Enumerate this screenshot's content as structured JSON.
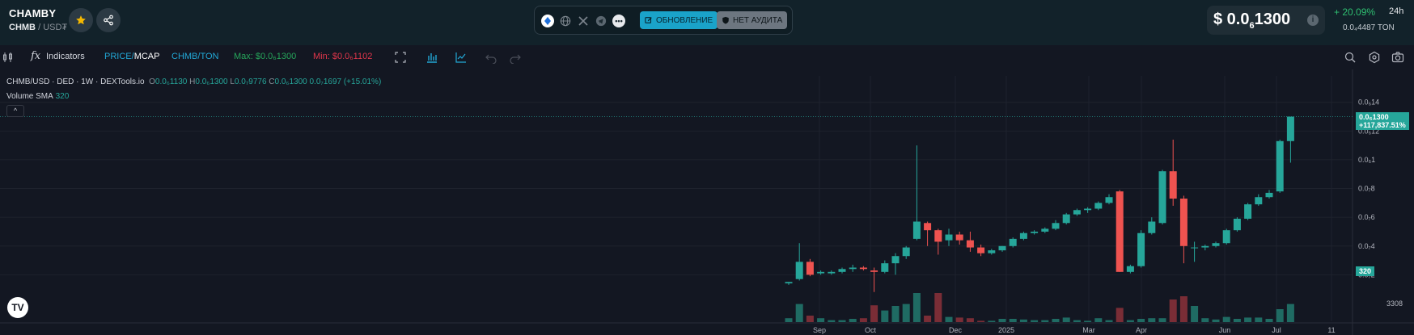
{
  "header": {
    "token_name": "CHAMBY",
    "pair_base": "CHMB",
    "pair_sep": "/",
    "pair_quote": "USD₮",
    "social": {
      "update_label": "ОБНОВЛЕНИЕ",
      "audit_label": "НЕТ АУДИТА"
    },
    "price": {
      "prefix": "$ 0.0",
      "subscript": "6",
      "suffix": "1300",
      "info": "i"
    },
    "change": "+ 20.09%",
    "change_period": "24h",
    "ton_price": "0.0₄4487  TON"
  },
  "toolbar": {
    "indicators": "Indicators",
    "price": "PRICE",
    "mcap": "MCAP",
    "pair": "CHMB/TON",
    "max": "Max: $0.0₆1300",
    "min": "Min: $0.0₆1102"
  },
  "legend": {
    "symbol": "CHMB/USD · DED · 1W · DEXTools.io",
    "o_label": "O",
    "o_val": "0.0₆1130",
    "h_label": "H",
    "h_val": "0.0₆1300",
    "l_label": "L",
    "l_val": "0.0₇9776",
    "c_label": "C",
    "c_val": "0.0₆1300 0.0₇1697 (+15.01%)",
    "volume": "Volume SMA",
    "volume_val": "320"
  },
  "colors": {
    "up": "#26a69a",
    "down": "#ef5350",
    "accent": "#22a8d6",
    "bg": "#131722"
  },
  "chart_data": {
    "type": "candlestick",
    "unit_note_ticks": [
      "0.0₆1",
      "0.0₆8",
      "0.0₆6",
      "0.0₆4",
      "0.0₆2"
    ],
    "y_ticks": [
      {
        "label": "0.0₆14",
        "value": 1.4
      },
      {
        "label": "0.0₆12",
        "value": 1.2
      },
      {
        "label": "0.0₆1",
        "value": 1.0
      },
      {
        "label": "0.0₇8",
        "value": 0.8
      },
      {
        "label": "0.0₇6",
        "value": 0.6
      },
      {
        "label": "0.0₇4",
        "value": 0.4
      },
      {
        "label": "0.0₇2",
        "value": 0.2
      }
    ],
    "x_ticks": [
      "Sep",
      "Oct",
      "Dec",
      "2025",
      "Mar",
      "Apr",
      "Jun",
      "Jul",
      "11"
    ],
    "last_price_tag": "0.0₆1300",
    "last_change_tag": "+117,837.51%",
    "volume_tag": "320",
    "volume_axis_label": "3308",
    "ylim": [
      0.0,
      1.55
    ],
    "candles": [
      {
        "o": 0.14,
        "h": 0.15,
        "l": 0.13,
        "c": 0.15
      },
      {
        "o": 0.17,
        "h": 0.42,
        "l": 0.16,
        "c": 0.29
      },
      {
        "o": 0.29,
        "h": 0.31,
        "l": 0.19,
        "c": 0.2
      },
      {
        "o": 0.21,
        "h": 0.23,
        "l": 0.2,
        "c": 0.22
      },
      {
        "o": 0.21,
        "h": 0.23,
        "l": 0.2,
        "c": 0.22
      },
      {
        "o": 0.22,
        "h": 0.25,
        "l": 0.21,
        "c": 0.24
      },
      {
        "o": 0.24,
        "h": 0.27,
        "l": 0.22,
        "c": 0.25
      },
      {
        "o": 0.25,
        "h": 0.26,
        "l": 0.23,
        "c": 0.24
      },
      {
        "o": 0.23,
        "h": 0.25,
        "l": 0.08,
        "c": 0.22
      },
      {
        "o": 0.22,
        "h": 0.3,
        "l": 0.21,
        "c": 0.28
      },
      {
        "o": 0.28,
        "h": 0.35,
        "l": 0.2,
        "c": 0.33
      },
      {
        "o": 0.33,
        "h": 0.4,
        "l": 0.31,
        "c": 0.39
      },
      {
        "o": 0.45,
        "h": 1.1,
        "l": 0.44,
        "c": 0.57
      },
      {
        "o": 0.56,
        "h": 0.57,
        "l": 0.4,
        "c": 0.51
      },
      {
        "o": 0.51,
        "h": 0.52,
        "l": 0.34,
        "c": 0.43
      },
      {
        "o": 0.44,
        "h": 0.52,
        "l": 0.4,
        "c": 0.48
      },
      {
        "o": 0.48,
        "h": 0.5,
        "l": 0.41,
        "c": 0.44
      },
      {
        "o": 0.44,
        "h": 0.5,
        "l": 0.36,
        "c": 0.39
      },
      {
        "o": 0.39,
        "h": 0.41,
        "l": 0.33,
        "c": 0.35
      },
      {
        "o": 0.35,
        "h": 0.38,
        "l": 0.34,
        "c": 0.37
      },
      {
        "o": 0.37,
        "h": 0.4,
        "l": 0.36,
        "c": 0.4
      },
      {
        "o": 0.4,
        "h": 0.46,
        "l": 0.39,
        "c": 0.45
      },
      {
        "o": 0.45,
        "h": 0.5,
        "l": 0.44,
        "c": 0.49
      },
      {
        "o": 0.49,
        "h": 0.51,
        "l": 0.48,
        "c": 0.5
      },
      {
        "o": 0.5,
        "h": 0.53,
        "l": 0.49,
        "c": 0.52
      },
      {
        "o": 0.52,
        "h": 0.58,
        "l": 0.51,
        "c": 0.56
      },
      {
        "o": 0.56,
        "h": 0.63,
        "l": 0.55,
        "c": 0.62
      },
      {
        "o": 0.62,
        "h": 0.66,
        "l": 0.61,
        "c": 0.65
      },
      {
        "o": 0.65,
        "h": 0.67,
        "l": 0.63,
        "c": 0.66
      },
      {
        "o": 0.66,
        "h": 0.71,
        "l": 0.65,
        "c": 0.7
      },
      {
        "o": 0.7,
        "h": 0.76,
        "l": 0.69,
        "c": 0.74
      },
      {
        "o": 0.78,
        "h": 0.79,
        "l": 0.22,
        "c": 0.22
      },
      {
        "o": 0.22,
        "h": 0.27,
        "l": 0.21,
        "c": 0.26
      },
      {
        "o": 0.26,
        "h": 0.51,
        "l": 0.25,
        "c": 0.49
      },
      {
        "o": 0.49,
        "h": 0.6,
        "l": 0.48,
        "c": 0.57
      },
      {
        "o": 0.56,
        "h": 0.93,
        "l": 0.55,
        "c": 0.92
      },
      {
        "o": 0.92,
        "h": 1.14,
        "l": 0.68,
        "c": 0.73
      },
      {
        "o": 0.73,
        "h": 0.75,
        "l": 0.28,
        "c": 0.4
      },
      {
        "o": 0.39,
        "h": 0.43,
        "l": 0.29,
        "c": 0.39
      },
      {
        "o": 0.39,
        "h": 0.41,
        "l": 0.37,
        "c": 0.4
      },
      {
        "o": 0.4,
        "h": 0.43,
        "l": 0.39,
        "c": 0.42
      },
      {
        "o": 0.42,
        "h": 0.52,
        "l": 0.41,
        "c": 0.51
      },
      {
        "o": 0.51,
        "h": 0.6,
        "l": 0.5,
        "c": 0.59
      },
      {
        "o": 0.59,
        "h": 0.7,
        "l": 0.58,
        "c": 0.69
      },
      {
        "o": 0.69,
        "h": 0.76,
        "l": 0.68,
        "c": 0.74
      },
      {
        "o": 0.74,
        "h": 0.79,
        "l": 0.73,
        "c": 0.77
      },
      {
        "o": 0.78,
        "h": 1.14,
        "l": 0.77,
        "c": 1.13
      },
      {
        "o": 1.13,
        "h": 1.3,
        "l": 0.98,
        "c": 1.3
      }
    ],
    "volumes": [
      0.06,
      0.28,
      0.1,
      0.06,
      0.03,
      0.03,
      0.05,
      0.06,
      0.26,
      0.18,
      0.25,
      0.28,
      0.45,
      0.1,
      0.45,
      0.08,
      0.07,
      0.06,
      0.02,
      0.02,
      0.05,
      0.05,
      0.04,
      0.03,
      0.03,
      0.05,
      0.07,
      0.03,
      0.02,
      0.06,
      0.03,
      0.22,
      0.03,
      0.05,
      0.06,
      0.06,
      0.35,
      0.4,
      0.25,
      0.06,
      0.04,
      0.08,
      0.05,
      0.07,
      0.07,
      0.05,
      0.2,
      0.28
    ]
  }
}
